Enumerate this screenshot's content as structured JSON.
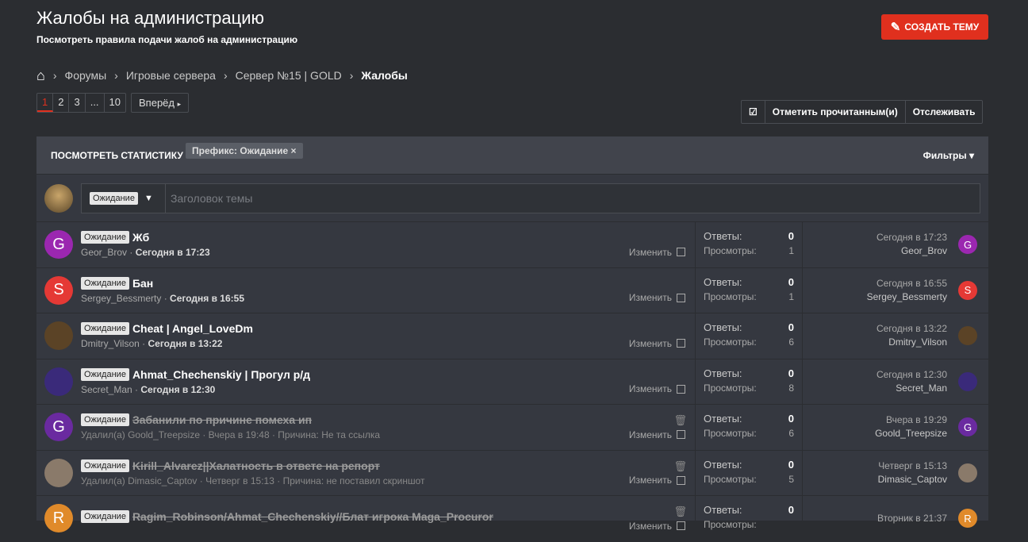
{
  "header": {
    "title": "Жалобы на администрацию",
    "subtitle": "Посмотреть правила подачи жалоб на администрацию",
    "create_label": "СОЗДАТЬ ТЕМУ"
  },
  "breadcrumb": [
    "Форумы",
    "Игровые сервера",
    "Сервер №15 | GOLD",
    "Жалобы"
  ],
  "pagination": {
    "pages": [
      "1",
      "2",
      "3",
      "...",
      "10"
    ],
    "next": "Вперёд"
  },
  "actions": {
    "mark_read": "Отметить прочитанным(и)",
    "watch": "Отслеживать"
  },
  "filterbar": {
    "stats": "ПОСМОТРЕТЬ СТАТИСТИКУ",
    "prefix": "Префикс: Ожидание",
    "filters": "Фильтры"
  },
  "new_thread": {
    "prefix": "Ожидание",
    "placeholder": "Заголовок темы"
  },
  "labels": {
    "replies": "Ответы:",
    "views": "Просмотры:",
    "edit": "Изменить"
  },
  "colors": {
    "accent": "#e0301e"
  },
  "threads": [
    {
      "prefix": "Ожидание",
      "title": "Жб",
      "author": "Geor_Brov",
      "date": "Сегодня в 17:23",
      "replies": "0",
      "views": "1",
      "last_date": "Сегодня в 17:23",
      "last_user": "Geor_Brov",
      "letter": "G",
      "color": "#9b27b0"
    },
    {
      "prefix": "Ожидание",
      "title": "Бан",
      "author": "Sergey_Bessmerty",
      "date": "Сегодня в 16:55",
      "replies": "0",
      "views": "1",
      "last_date": "Сегодня в 16:55",
      "last_user": "Sergey_Bessmerty",
      "letter": "S",
      "color": "#e53935"
    },
    {
      "prefix": "Ожидание",
      "title": "Cheat | Angel_LoveDm",
      "author": "Dmitry_Vilson",
      "date": "Сегодня в 13:22",
      "replies": "0",
      "views": "6",
      "last_date": "Сегодня в 13:22",
      "last_user": "Dmitry_Vilson",
      "letter": "",
      "color": "#5b4326"
    },
    {
      "prefix": "Ожидание",
      "title": "Ahmat_Chechenskiy | Прогул р/д",
      "author": "Secret_Man",
      "date": "Сегодня в 12:30",
      "replies": "0",
      "views": "8",
      "last_date": "Сегодня в 12:30",
      "last_user": "Secret_Man",
      "letter": "",
      "color": "#3a2a7a"
    },
    {
      "prefix": "Ожидание",
      "title": "Забанили по причине помеха ип",
      "meta": "Удалил(а) Goold_Treepsize · Вчера в 19:48 · Причина: Не та ссылка",
      "replies": "0",
      "views": "6",
      "last_date": "Вчера в 19:29",
      "last_user": "Goold_Treepsize",
      "letter": "G",
      "color": "#6a2aa0"
    },
    {
      "prefix": "Ожидание",
      "title": "Kirill_Alvarez||Халатность в ответе на репорт",
      "meta": "Удалил(а) Dimasic_Captov · Четверг в 15:13 · Причина: не поставил скриншот",
      "replies": "0",
      "views": "5",
      "last_date": "Четверг в 15:13",
      "last_user": "Dimasic_Captov",
      "letter": "",
      "color": "#8a7a6a"
    },
    {
      "prefix": "Ожидание",
      "title": "Ragim_Robinson/Ahmat_Chechenskiy//Блат игрока Maga_Procuror",
      "meta": "",
      "replies": "0",
      "views": "",
      "last_date": "Вторник в 21:37",
      "last_user": "",
      "letter": "R",
      "color": "#e08a2a"
    }
  ]
}
